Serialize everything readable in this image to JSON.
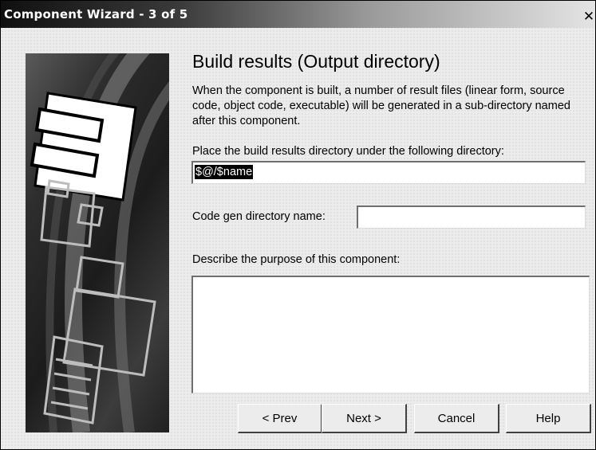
{
  "window": {
    "title": "Component Wizard -  3 of 5",
    "close_glyph": "✕"
  },
  "page": {
    "heading": "Build results (Output directory)",
    "description": "When the component is built, a number of result files (linear form, source code, object code, executable) will be generated in a sub-directory named after this component.",
    "directory_label": "Place the build results directory under the following directory:",
    "directory_value": "$@/$name",
    "codegen_label": "Code gen directory name:",
    "codegen_value": "",
    "purpose_label": "Describe the purpose of this component:",
    "purpose_value": ""
  },
  "buttons": {
    "prev": "< Prev",
    "next": "Next >",
    "cancel": "Cancel",
    "help": "Help"
  },
  "icons": {
    "banner": "component-wizard-banner",
    "close": "close-icon"
  }
}
